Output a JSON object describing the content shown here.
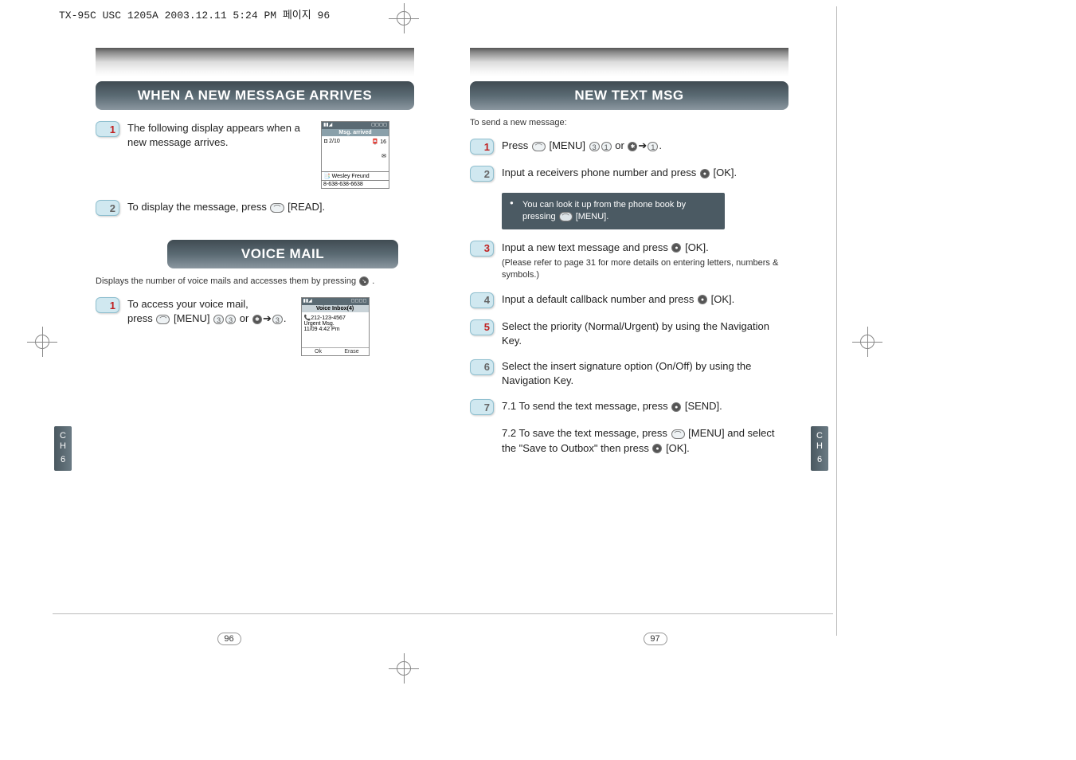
{
  "doc_info": "TX-95C USC 1205A  2003.12.11 5:24 PM  페이지 96",
  "left": {
    "heading1": "WHEN A NEW MESSAGE ARRIVES",
    "step1": "The following display appears when a new message arrives.",
    "step2": "To display the message, press       [READ].",
    "heading2": "VOICE MAIL",
    "intro2": "Displays the number of voice mails and accesses them by pressing       .",
    "vm_step1": "To access your voice mail, press      [MENU]             or           .",
    "screenshot1": {
      "title": "Msg. arrived",
      "row_left": "◘ 2/10",
      "row_right": "📮 16",
      "footer_name": "📑 Wesley Freund",
      "footer_num": "8-638-638-6638"
    },
    "screenshot2": {
      "title": "Voice Inbox(4)",
      "line1": "📞212-123-4567",
      "line2": "Urgent Msg.",
      "line3": "11/09  4:42 Pm",
      "btn_left": "Ok",
      "btn_right": "Erase"
    },
    "page_num": "96"
  },
  "right": {
    "heading1": "NEW TEXT MSG",
    "intro": "To send a new message:",
    "step1": "Press      [MENU]          or          .",
    "step2": "Input a receivers phone number and press      [OK].",
    "note": "You can look it up from the phone book by pressing       [MENU].",
    "step3": "Input a new text message and press      [OK].",
    "step3_sub": "(Please refer to page 31 for more details on entering letters, numbers & symbols.)",
    "step4": "Input a default callback number and press      [OK].",
    "step5": "Select the priority (Normal/Urgent) by using the Navigation Key.",
    "step6": "Select the insert signature option (On/Off) by using the Navigation Key.",
    "step7_1": "7.1 To send the text message, press      [SEND].",
    "step7_2": "7.2 To save the text message, press      [MENU] and select the \"Save to Outbox\" then press      [OK].",
    "page_num": "97"
  },
  "ch_label_line1": "C",
  "ch_label_line2": "H",
  "ch_label_line3": "6"
}
